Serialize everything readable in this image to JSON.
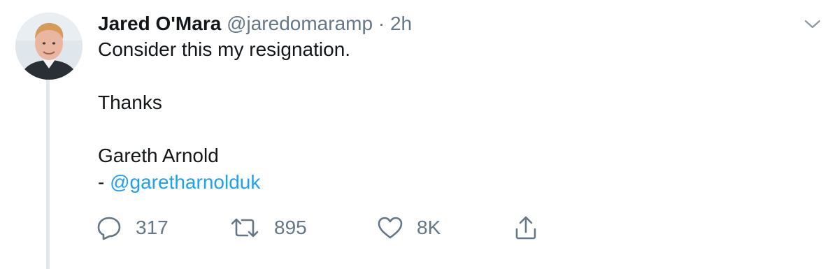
{
  "tweet": {
    "display_name": "Jared O'Mara",
    "handle": "@jaredomaramp",
    "separator": "·",
    "time": "2h",
    "lines": [
      "Consider this my resignation.",
      "Thanks",
      "Gareth Arnold",
      "- "
    ],
    "mention": "@garetharnolduk"
  },
  "actions": {
    "reply_count": "317",
    "retweet_count": "895",
    "like_count": "8K"
  },
  "icons": {
    "more": "chevron-down-icon",
    "reply": "reply-icon",
    "retweet": "retweet-icon",
    "like": "heart-icon",
    "share": "share-icon"
  },
  "colors": {
    "text": "#14171a",
    "muted": "#657786",
    "link": "#1da1f2",
    "thread_line": "#e1e8ed"
  }
}
